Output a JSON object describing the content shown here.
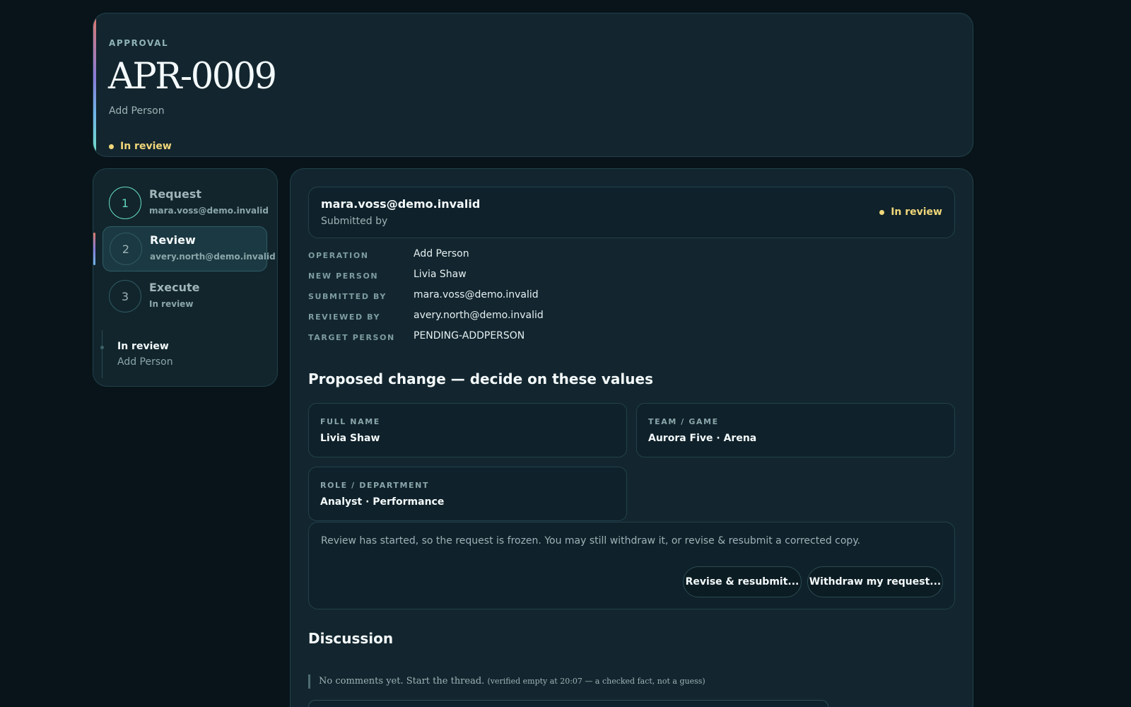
{
  "header": {
    "eyebrow": "APPROVAL",
    "title": "APR-0009",
    "subtitle": "Add Person",
    "status": "In review"
  },
  "steps": [
    {
      "number": "1",
      "title": "Request",
      "meta": "mara.voss@demo.invalid",
      "state": "done"
    },
    {
      "number": "2",
      "title": "Review",
      "meta": "avery.north@demo.invalid",
      "state": "active"
    },
    {
      "number": "3",
      "title": "Execute",
      "meta": "In review",
      "state": "pending"
    }
  ],
  "steps_footer": {
    "title": "In review",
    "subtitle": "Add Person"
  },
  "submitter": {
    "email": "mara.voss@demo.invalid",
    "label": "Submitted by",
    "status": "In review"
  },
  "details": [
    {
      "key": "OPERATION",
      "value": "Add Person"
    },
    {
      "key": "NEW PERSON",
      "value": "Livia Shaw"
    },
    {
      "key": "SUBMITTED BY",
      "value": "mara.voss@demo.invalid"
    },
    {
      "key": "REVIEWED BY",
      "value": "avery.north@demo.invalid"
    },
    {
      "key": "TARGET PERSON",
      "value": "PENDING-ADDPERSON"
    }
  ],
  "proposed": {
    "title": "Proposed change — decide on these values",
    "fields": [
      {
        "label": "FULL NAME",
        "value": "Livia Shaw"
      },
      {
        "label": "TEAM / GAME",
        "value": "Aurora Five · Arena"
      },
      {
        "label": "ROLE / DEPARTMENT",
        "value": "Analyst · Performance"
      }
    ]
  },
  "notice": {
    "text": "Review has started, so the request is frozen. You may still withdraw it, or revise & resubmit a corrected copy.",
    "revise_label": "Revise & resubmit...",
    "withdraw_label": "Withdraw my request..."
  },
  "discussion": {
    "title": "Discussion",
    "empty_text": "No comments yet. Start the thread.",
    "verified_note": "(verified empty at 20:07 — a checked fact, not a guess)"
  },
  "colors": {
    "status": "#f0d77a",
    "accent_done": "#63d6be",
    "background": "#081419",
    "panel": "#13262f"
  }
}
